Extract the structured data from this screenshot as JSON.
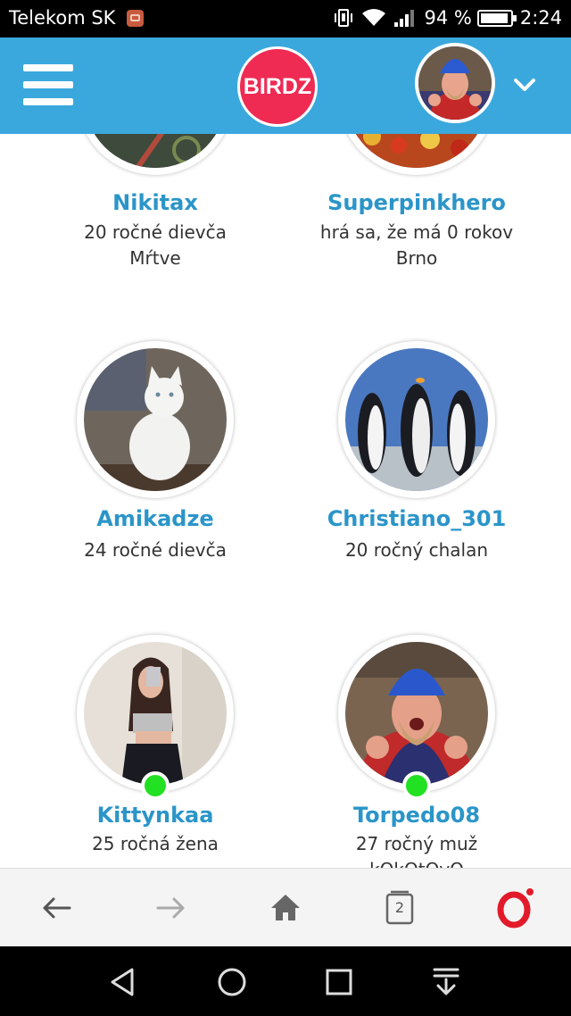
{
  "status_bar": {
    "carrier": "Telekom SK",
    "battery": "94 %",
    "time": "2:24"
  },
  "header": {
    "logo_text": "BIRDZ",
    "menu_icon": "hamburger-menu-icon",
    "dropdown_icon": "chevron-down-icon"
  },
  "colors": {
    "header": "#3aa8dd",
    "logo": "#ef2a53",
    "username": "#2b95c9",
    "online": "#22e022"
  },
  "profiles": [
    {
      "name": "Nikitax",
      "line1": "20 ročné dievča",
      "line2": "Mŕtve",
      "online": false,
      "photo": "dark-photo"
    },
    {
      "name": "Superpinkhero",
      "line1": "hrá sa, že má 0 rokov",
      "line2": "Brno",
      "online": false,
      "photo": "market-photo"
    },
    {
      "name": "Amikadze",
      "line1": "24 ročné dievča",
      "line2": "",
      "online": false,
      "photo": "white-cat-photo"
    },
    {
      "name": "Christiano_301",
      "line1": "20 ročný chalan",
      "line2": "",
      "online": false,
      "photo": "penguins-photo"
    },
    {
      "name": "Kittynkaa",
      "line1": "25 ročná žena",
      "line2": "",
      "online": true,
      "photo": "girl-selfie-photo"
    },
    {
      "name": "Torpedo08",
      "line1": "27 ročný muž",
      "line2": "kOkOtOvO",
      "online": true,
      "photo": "man-blue-hat-photo"
    }
  ],
  "browser_bar": {
    "tabs_count": "2",
    "icons": [
      "back-arrow-icon",
      "forward-arrow-icon",
      "home-icon",
      "tabs-icon",
      "opera-icon"
    ]
  },
  "nav_bar": {
    "icons": [
      "back-triangle-icon",
      "home-circle-icon",
      "recents-square-icon",
      "notification-pull-icon"
    ]
  }
}
